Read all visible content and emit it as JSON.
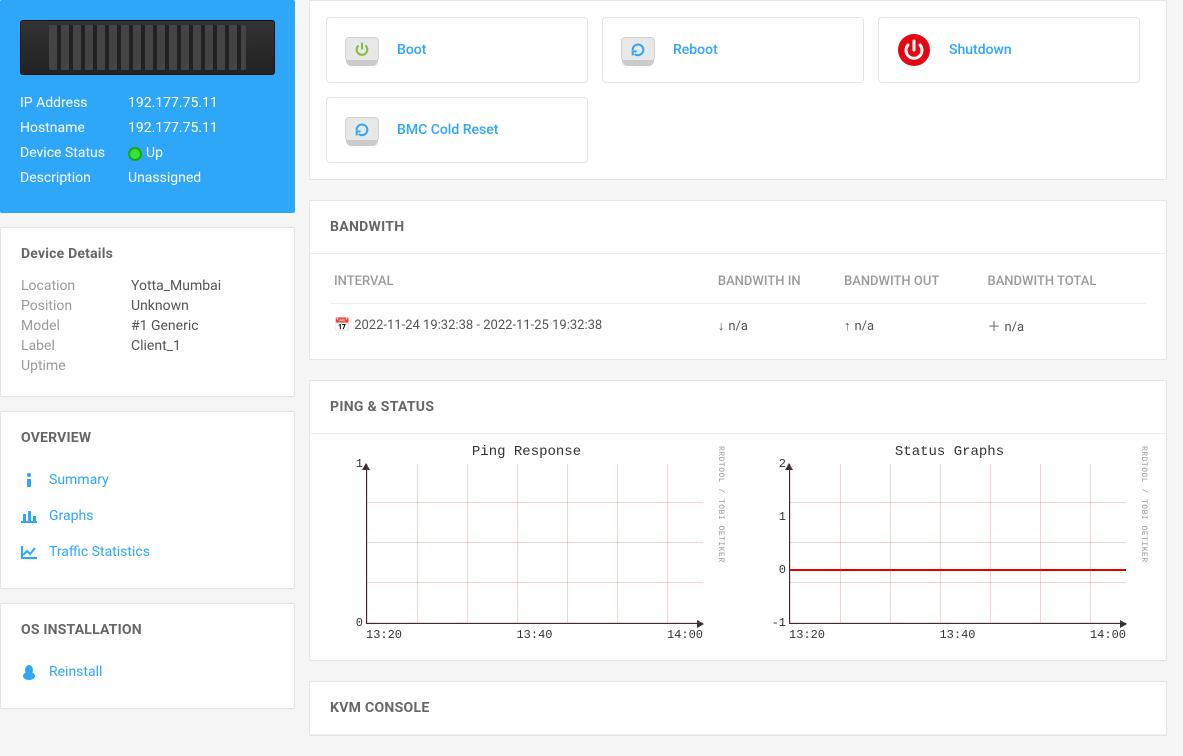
{
  "device": {
    "ip_label": "IP Address",
    "ip": "192.177.75.11",
    "hostname_label": "Hostname",
    "hostname": "192.177.75.11",
    "status_label": "Device Status",
    "status_value": "Up",
    "desc_label": "Description",
    "desc": "Unassigned"
  },
  "device_details": {
    "title": "Device Details",
    "location_label": "Location",
    "location": "Yotta_Mumbai",
    "position_label": "Position",
    "position": "Unknown",
    "model_label": "Model",
    "model": "#1 Generic",
    "label_label": "Label",
    "label": "Client_1",
    "uptime_label": "Uptime",
    "uptime": ""
  },
  "overview": {
    "title": "OVERVIEW",
    "items": [
      {
        "icon": "info-icon",
        "label": "Summary"
      },
      {
        "icon": "barchart-icon",
        "label": "Graphs"
      },
      {
        "icon": "linechart-icon",
        "label": "Traffic Statistics"
      }
    ]
  },
  "os_install": {
    "title": "OS INSTALLATION",
    "items": [
      {
        "icon": "penguin-icon",
        "label": "Reinstall"
      }
    ]
  },
  "actions": {
    "boot": "Boot",
    "reboot": "Reboot",
    "shutdown": "Shutdown",
    "bmc": "BMC Cold Reset"
  },
  "bandwidth": {
    "title": "BANDWITH",
    "cols": {
      "interval": "INTERVAL",
      "in": "BANDWITH IN",
      "out": "BANDWITH OUT",
      "total": "BANDWITH TOTAL"
    },
    "row": {
      "interval": "2022-11-24 19:32:38 - 2022-11-25 19:32:38",
      "in": "n/a",
      "out": "n/a",
      "total": "n/a"
    }
  },
  "ping_status": {
    "title": "PING & STATUS"
  },
  "kvm": {
    "title": "KVM CONSOLE"
  },
  "chart_data": [
    {
      "type": "line",
      "title": "Ping Response",
      "x": [
        "13:20",
        "13:40",
        "14:00"
      ],
      "series": [
        {
          "name": "ping",
          "values": [
            null,
            null,
            null
          ]
        }
      ],
      "ylim": [
        0,
        1
      ],
      "y_ticks": [
        0,
        1
      ],
      "xlabel": "",
      "ylabel": ""
    },
    {
      "type": "line",
      "title": "Status Graphs",
      "x": [
        "13:20",
        "13:40",
        "14:00"
      ],
      "series": [
        {
          "name": "status",
          "values": [
            0,
            0,
            0
          ]
        }
      ],
      "ylim": [
        -1,
        2
      ],
      "y_ticks": [
        -1,
        0,
        1,
        2
      ],
      "xlabel": "",
      "ylabel": ""
    }
  ],
  "chart_tool_text": "RRDTOOL / TOBI OETIKER"
}
